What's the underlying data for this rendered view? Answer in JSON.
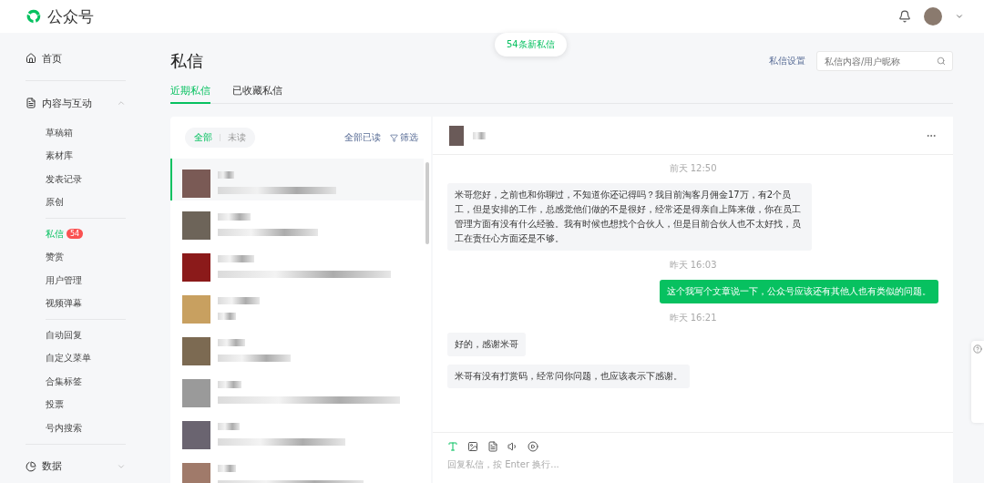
{
  "header": {
    "brand": "公众号"
  },
  "toast": {
    "text": "54条新私信"
  },
  "sidebar": {
    "sections": [
      {
        "kind": "link",
        "label": "首页",
        "selected": false
      },
      {
        "kind": "group",
        "label": "内容与互动",
        "expanded": true,
        "groups": [
          [
            {
              "label": "草稿箱",
              "selected": false
            },
            {
              "label": "素材库",
              "selected": false
            },
            {
              "label": "发表记录",
              "selected": false
            },
            {
              "label": "原创",
              "selected": false
            }
          ],
          [
            {
              "label": "私信",
              "selected": true,
              "badge": "54"
            },
            {
              "label": "赞赏",
              "selected": false
            },
            {
              "label": "用户管理",
              "selected": false
            },
            {
              "label": "视频弹幕",
              "selected": false
            }
          ],
          [
            {
              "label": "自动回复",
              "selected": false
            },
            {
              "label": "自定义菜单",
              "selected": false
            },
            {
              "label": "合集标签",
              "selected": false
            },
            {
              "label": "投票",
              "selected": false
            },
            {
              "label": "号内搜索",
              "selected": false
            }
          ]
        ]
      },
      {
        "kind": "group",
        "label": "数据",
        "expanded": false
      }
    ]
  },
  "page": {
    "title": "私信",
    "settings_link": "私信设置",
    "search": {
      "placeholder": "私信内容/用户昵称"
    },
    "tabs": [
      {
        "label": "近期私信",
        "selected": true
      },
      {
        "label": "已收藏私信",
        "selected": false
      }
    ]
  },
  "list": {
    "filters": [
      {
        "label": "全部",
        "selected": true
      },
      {
        "label": "未读",
        "selected": false
      }
    ],
    "mark_all_read": "全部已读",
    "filter": "筛选",
    "conversations": [
      {
        "selected": true
      },
      {
        "selected": false
      },
      {
        "selected": false
      },
      {
        "selected": false
      },
      {
        "selected": false
      },
      {
        "selected": false
      },
      {
        "selected": false
      },
      {
        "selected": false
      }
    ]
  },
  "chat": {
    "messages": [
      {
        "kind": "time",
        "text": "前天 12:50"
      },
      {
        "kind": "incoming",
        "text": "米哥您好，之前也和你聊过，不知道你还记得吗？我目前淘客月佣金17万，有2个员工，但是安排的工作，总感觉他们做的不是很好，经常还是得亲自上阵来做，你在员工管理方面有没有什么经验。我有时候也想找个合伙人，但是目前合伙人也不太好找，员工在责任心方面还是不够。"
      },
      {
        "kind": "time",
        "text": "昨天 16:03"
      },
      {
        "kind": "outgoing",
        "text": "这个我写个文章说一下，公众号应该还有其他人也有类似的问题。"
      },
      {
        "kind": "time",
        "text": "昨天 16:21"
      },
      {
        "kind": "incoming",
        "text": "好的，感谢米哥"
      },
      {
        "kind": "incoming",
        "text": "米哥有没有打赏码，经常问你问题，也应该表示下感谢。"
      }
    ],
    "composer": {
      "tools": [
        {
          "kind": "text",
          "selected": true
        },
        {
          "kind": "image",
          "selected": false
        },
        {
          "kind": "article",
          "selected": false
        },
        {
          "kind": "audio",
          "selected": false
        },
        {
          "kind": "video",
          "selected": false
        }
      ],
      "placeholder": "回复私信，按 Enter 换行..."
    }
  }
}
